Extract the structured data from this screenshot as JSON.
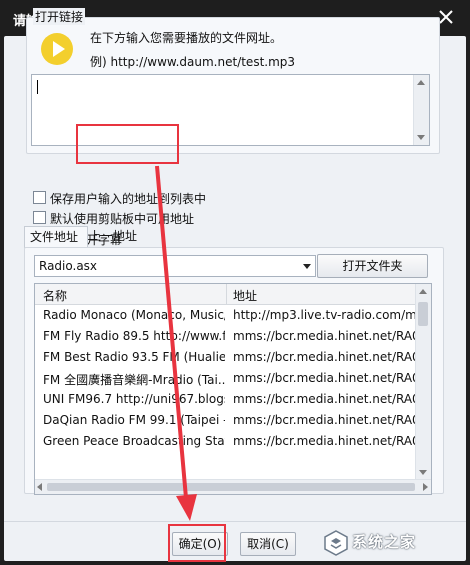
{
  "window": {
    "title": "请输入地址。"
  },
  "open_link": {
    "legend": "打开链接",
    "hint": "在下方输入您需要播放的文件网址。",
    "example": "例) http://www.daum.net/test.mp3",
    "url_value": ""
  },
  "options": [
    {
      "label": "保存用户输入的地址到列表中",
      "checked": false
    },
    {
      "label": "默认使用剪贴板中可用地址",
      "checked": false
    },
    {
      "label": "同时打开字幕",
      "checked": true
    }
  ],
  "tabs": [
    {
      "label": "文件地址",
      "active": true
    },
    {
      "label": "上一地址",
      "active": false
    }
  ],
  "file_select": {
    "selected": "Radio.asx",
    "open_folder_label": "打开文件夹"
  },
  "list": {
    "columns": [
      "名称",
      "地址"
    ],
    "rows": [
      [
        "Radio Monaco (Monaco, Music/...",
        "http://mp3.live.tv-radio.com/m..."
      ],
      [
        "FM Fly Radio 89.5 http://www.fly...",
        "mms://bcr.media.hinet.net/RA0..."
      ],
      [
        "FM Best Radio 93.5 FM (Hualien ...",
        "mms://bcr.media.hinet.net/RA0..."
      ],
      [
        "FM 全國廣播音樂網-Mradio (Tai...",
        "mms://bcr.media.hinet.net/RA0..."
      ],
      [
        "UNI FM96.7 http://uni967.blogsp...",
        "mms://bcr.media.hinet.net/RA0..."
      ],
      [
        "DaQian Radio FM 99.1 (Taipei - T...",
        "mms://bcr.media.hinet.net/RA0..."
      ],
      [
        "Green Peace Broadcasting Statio...",
        "mms://bcr.media.hinet.net/RA0..."
      ]
    ]
  },
  "buttons": {
    "ok": "确定(O)",
    "cancel": "取消(C)"
  },
  "watermark": {
    "text": "系统之家"
  },
  "colors": {
    "titlebar": "#1e1e1e",
    "dialog_bg": "#eef1f5",
    "annotation_red": "#e8343f",
    "play_icon": "#f3cf2d"
  }
}
